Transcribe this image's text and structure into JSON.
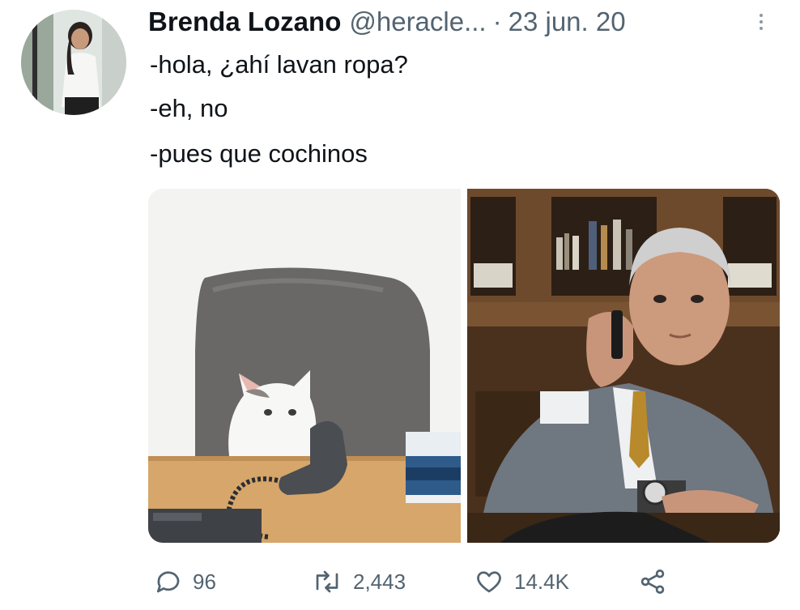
{
  "tweet": {
    "author_name": "Brenda Lozano",
    "author_handle": "@heracle...",
    "separator": "·",
    "date": "23 jun. 20",
    "lines": [
      "-hola, ¿ahí lavan ropa?",
      "-eh, no",
      "-pues que cochinos"
    ]
  },
  "actions": {
    "replies": "96",
    "retweets": "2,443",
    "likes": "14.4K"
  },
  "icons": {
    "more": "more-vertical-icon",
    "reply": "reply-icon",
    "retweet": "retweet-icon",
    "like": "heart-icon",
    "share": "share-icon"
  }
}
